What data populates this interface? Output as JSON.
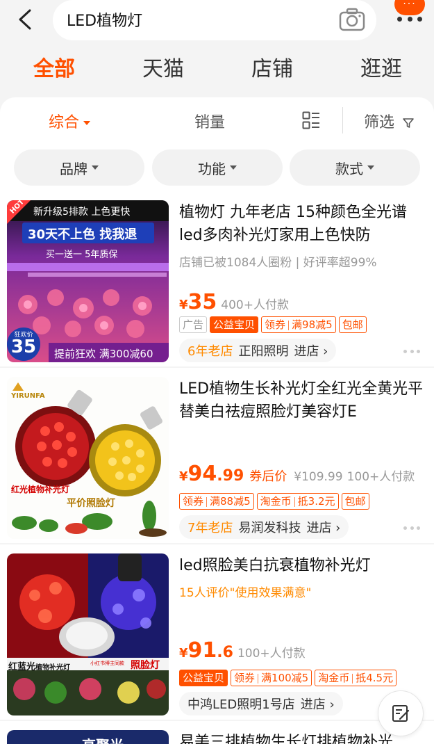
{
  "search": {
    "query": "LED植物灯",
    "more_badge": "···"
  },
  "tabs": [
    {
      "label": "全部",
      "active": true
    },
    {
      "label": "天猫",
      "active": false
    },
    {
      "label": "店铺",
      "active": false
    },
    {
      "label": "逛逛",
      "active": false
    }
  ],
  "sort": {
    "comprehensive": "综合",
    "sales": "销量",
    "filter": "筛选"
  },
  "chips": [
    "品牌",
    "功能",
    "款式"
  ],
  "products": [
    {
      "title": "植物灯 九年老店 15种颜色全光谱led多肉补光灯家用上色快防",
      "sub": "店铺已被1084人圈粉 | 好评率超99%",
      "yen": "¥",
      "price_int": "35",
      "price_dec": "",
      "paid": "400+人付款",
      "tags": [
        "广告",
        "公益宝贝",
        "领券",
        "满98减5",
        "包邮"
      ],
      "shop_years": "6年老店",
      "shop_name": "正阳照明",
      "enter": "进店 ›",
      "img": {
        "hot": "HOT",
        "line1": "新升级5排款 上色更快",
        "line2": "30天不上色 找我退",
        "line3": "买一送一 5年质保",
        "badge_top": "狂欢价",
        "badge_num": "35",
        "promo": "提前狂欢 满300减60"
      }
    },
    {
      "title": "LED植物生长补光灯全红光全黄光平替美白祛痘照脸灯美容灯E",
      "sub": "",
      "yen": "¥",
      "price_int": "94",
      "price_dec": ".99",
      "after": "券后价",
      "orig": "¥109.99",
      "paid": "100+人付款",
      "tags": [
        "领券",
        "满88减5",
        "淘金币",
        "抵3.2元",
        "包邮"
      ],
      "shop_years": "7年老店",
      "shop_name": "易润发科技",
      "enter": "进店 ›",
      "img": {
        "brand": "YIRUNFA",
        "label1": "红光植物补光灯",
        "label2": "平价照脸灯"
      }
    },
    {
      "title": "led照脸美白抗衰植物补光灯",
      "sub": "15人评价\"使用效果满意\"",
      "yen": "¥",
      "price_int": "91",
      "price_dec": ".6",
      "paid": "100+人付款",
      "tags": [
        "公益宝贝",
        "领券",
        "满100减5",
        "淘金币",
        "抵4.5元"
      ],
      "shop_years": "",
      "shop_name": "中鸿LED照明1号店",
      "enter": "进店 ›",
      "img": {
        "label1": "红蓝光",
        "label1b": "植物补光灯",
        "label2": "照脸灯",
        "tiny": "小红书博主同款"
      }
    },
    {
      "title": "易美三排植物生长灯排植物补光",
      "img": {
        "label": "高聚光"
      }
    }
  ],
  "colors": {
    "accent": "#ff5000",
    "accent_soft": "#ff8a00"
  }
}
